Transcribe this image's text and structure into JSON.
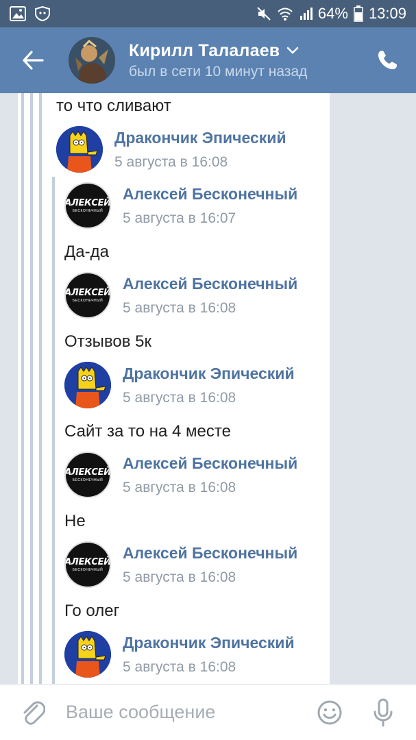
{
  "status_bar": {
    "battery": "64%",
    "time": "13:09",
    "icons": [
      "gallery-icon",
      "shield-icon",
      "mute-icon",
      "wifi-icon",
      "signal-icon",
      "battery-icon"
    ]
  },
  "header": {
    "name": "Кирилл Талалаев",
    "status": "был в сети 10 минут назад",
    "colors": {
      "bar": "#5b82b1",
      "status_bar": "#485f7b"
    }
  },
  "messages": {
    "top_text": "то что сливают",
    "forwards": [
      {
        "author": "Дракончик Эпический",
        "time": "5 августа в 16:08",
        "avatar": "bart"
      },
      {
        "author": "Алексей Бесконечный",
        "time": "5 августа в 16:07",
        "avatar": "alexey",
        "text": "Да-да"
      },
      {
        "author": "Алексей Бесконечный",
        "time": "5 августа в 16:08",
        "avatar": "alexey",
        "text": "Отзывов 5к"
      },
      {
        "author": "Дракончик Эпический",
        "time": "5 августа в 16:08",
        "avatar": "bart",
        "text": "Сайт за то на 4 месте"
      },
      {
        "author": "Алексей Бесконечный",
        "time": "5 августа в 16:08",
        "avatar": "alexey",
        "text": "Не"
      },
      {
        "author": "Алексей Бесконечный",
        "time": "5 августа в 16:08",
        "avatar": "alexey",
        "text": "Го олег"
      },
      {
        "author": "Дракончик Эпический",
        "time": "5 августа в 16:08",
        "avatar": "bart"
      }
    ],
    "avatar_text": {
      "alexey_main": "АЛЕКСЕЙ",
      "alexey_sub": "БЕСКОНЕЧНЫЙ"
    }
  },
  "composer": {
    "placeholder": "Ваше сообщение"
  }
}
